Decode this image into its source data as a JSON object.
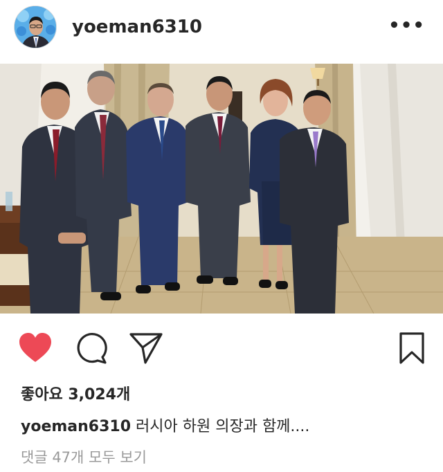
{
  "post": {
    "username": "yoeman6310",
    "more_label": "•••",
    "likes_text": "좋아요 3,024개",
    "caption_user": "yoeman6310",
    "caption_text": " 러시아 하원 의장과 함께....",
    "comments_link": "댓글 47개 모두 보기"
  },
  "icons": {
    "like": "heart-icon",
    "comment": "comment-icon",
    "share": "send-icon",
    "save": "bookmark-icon"
  },
  "colors": {
    "like_active": "#ed4956",
    "text": "#262626",
    "muted": "#999999"
  }
}
